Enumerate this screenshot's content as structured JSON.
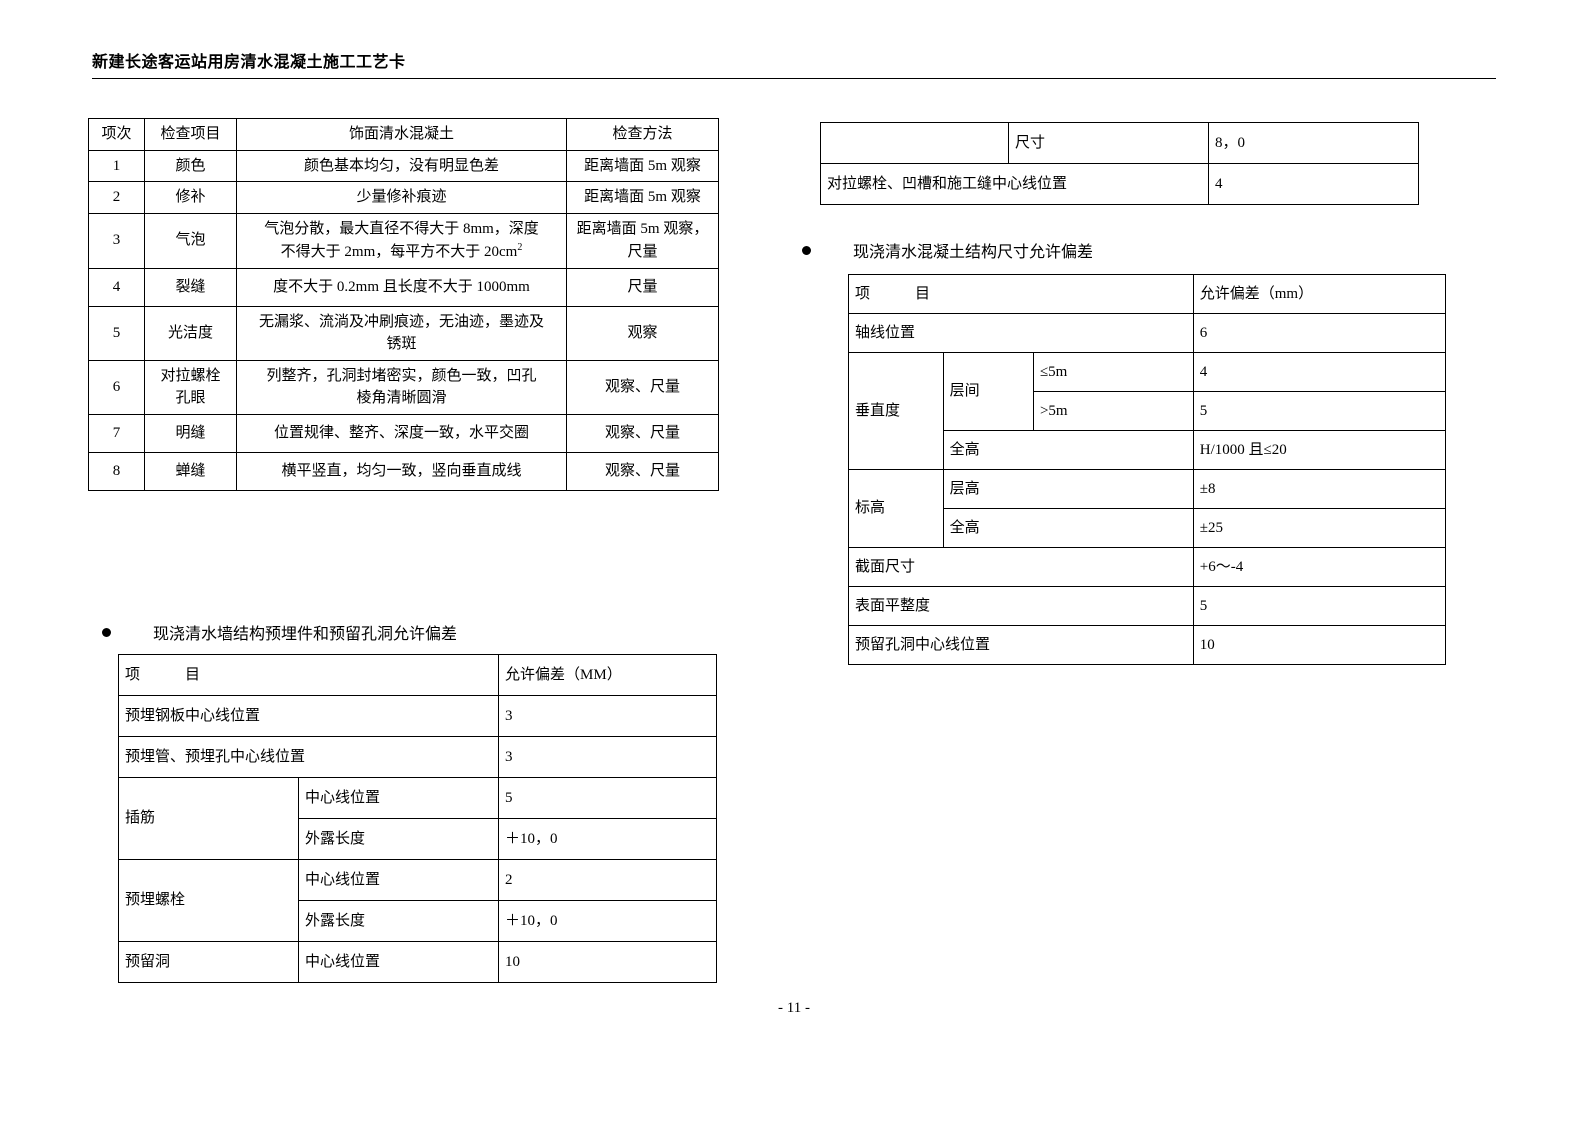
{
  "header": {
    "title": "新建长途客运站用房清水混凝土施工工艺卡"
  },
  "inspection_table": {
    "headers": [
      "项次",
      "检查项目",
      "饰面清水混凝土",
      "检查方法"
    ],
    "rows": [
      {
        "no": "1",
        "item": "颜色",
        "content": "颜色基本均匀，没有明显色差",
        "method": "距离墙面 5m 观察"
      },
      {
        "no": "2",
        "item": "修补",
        "content": "少量修补痕迹",
        "method": "距离墙面 5m 观察"
      },
      {
        "no": "3",
        "item": "气泡",
        "content_line1": "气泡分散，最大直径不得大于 8mm，深度",
        "content_line2": "不得大于 2mm，每平方不大于 20cm",
        "content_line2_sup": "2",
        "method_line1": "距离墙面 5m 观察，",
        "method_line2": "尺量"
      },
      {
        "no": "4",
        "item": "裂缝",
        "content": "度不大于 0.2mm 且长度不大于 1000mm",
        "method": "尺量"
      },
      {
        "no": "5",
        "item": "光洁度",
        "content_line1": "无漏浆、流淌及冲刷痕迹，无油迹，墨迹及",
        "content_line2": "锈斑",
        "method": "观察"
      },
      {
        "no": "6",
        "item_line1": "对拉螺栓",
        "item_line2": "孔眼",
        "content_line1": "列整齐，孔洞封堵密实，颜色一致，凹孔",
        "content_line2": "棱角清晰圆滑",
        "method": "观察、尺量"
      },
      {
        "no": "7",
        "item": "明缝",
        "content": "位置规律、整齐、深度一致，水平交圈",
        "method": "观察、尺量"
      },
      {
        "no": "8",
        "item": "蝉缝",
        "content": "横平竖直，均匀一致，竖向垂直成线",
        "method": "观察、尺量"
      }
    ]
  },
  "fragment_table": {
    "rows": [
      {
        "label": "尺寸",
        "value": "8，0"
      },
      {
        "label": "对拉螺栓、凹槽和施工缝中心线位置",
        "value": "4"
      }
    ]
  },
  "embed_section": {
    "bullet_title": "现浇清水墙结构预埋件和预留孔洞允许偏差",
    "headers": [
      "项　　　目",
      "允许偏差（MM）"
    ],
    "rows": [
      {
        "name": "预埋钢板中心线位置",
        "sub": "",
        "value": "3"
      },
      {
        "name": "预埋管、预埋孔中心线位置",
        "sub": "",
        "value": "3"
      },
      {
        "name": "插筋",
        "sub": "中心线位置",
        "value": "5"
      },
      {
        "name": "插筋",
        "sub": "外露长度",
        "value": "＋10，0"
      },
      {
        "name": "预埋螺栓",
        "sub": "中心线位置",
        "value": "2"
      },
      {
        "name": "预埋螺栓",
        "sub": "外露长度",
        "value": "＋10，0"
      },
      {
        "name": "预留洞",
        "sub": "中心线位置",
        "value": "10"
      }
    ]
  },
  "struct_section": {
    "bullet_title": "现浇清水混凝土结构尺寸允许偏差",
    "headers": [
      "项　　　目",
      "允许偏差（mm）"
    ],
    "rows": [
      {
        "name": "轴线位置",
        "sub": "",
        "sub2": "",
        "value": "6"
      },
      {
        "name": "垂直度",
        "sub": "层间",
        "sub2": "≤5m",
        "value": "4"
      },
      {
        "name": "垂直度",
        "sub": "层间",
        "sub2": ">5m",
        "value": "5"
      },
      {
        "name": "垂直度",
        "sub": "全高",
        "sub2": "",
        "value": "H/1000 且≤20"
      },
      {
        "name": "标高",
        "sub": "层高",
        "sub2": "",
        "value": "±8"
      },
      {
        "name": "标高",
        "sub": "全高",
        "sub2": "",
        "value": "±25"
      },
      {
        "name": "截面尺寸",
        "sub": "",
        "sub2": "",
        "value": "+6～-4"
      },
      {
        "name": "表面平整度",
        "sub": "",
        "sub2": "",
        "value": "5"
      },
      {
        "name": "预留孔洞中心线位置",
        "sub": "",
        "sub2": "",
        "value": "10"
      }
    ]
  },
  "footer": {
    "page_number": "- 11 -"
  }
}
